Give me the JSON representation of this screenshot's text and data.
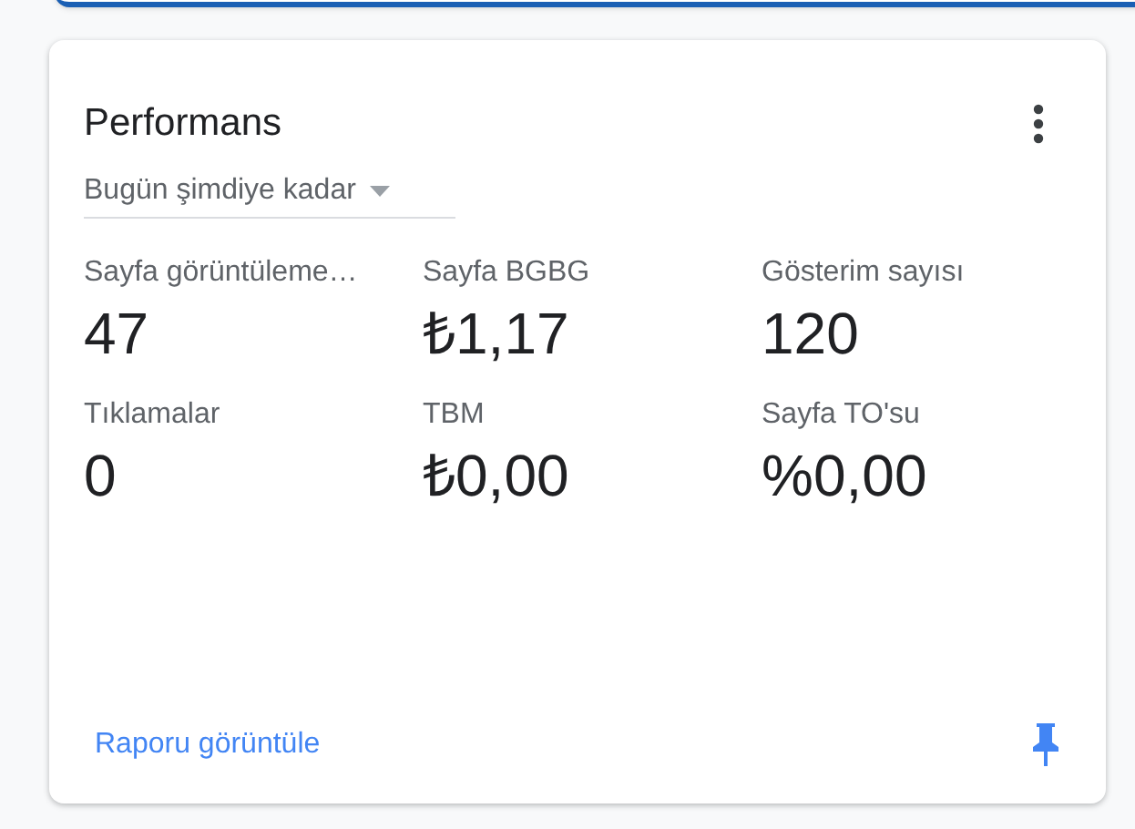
{
  "card": {
    "title": "Performans",
    "period": "Bugün şimdiye kadar",
    "metrics": [
      {
        "label": "Sayfa görüntüleme…",
        "value": "47"
      },
      {
        "label": "Sayfa BGBG",
        "value": "₺1,17"
      },
      {
        "label": "Gösterim sayısı",
        "value": "120"
      },
      {
        "label": "Tıklamalar",
        "value": "0"
      },
      {
        "label": "TBM",
        "value": "₺0,00"
      },
      {
        "label": "Sayfa TO'su",
        "value": "%0,00"
      }
    ],
    "link": "Raporu görüntüle"
  }
}
